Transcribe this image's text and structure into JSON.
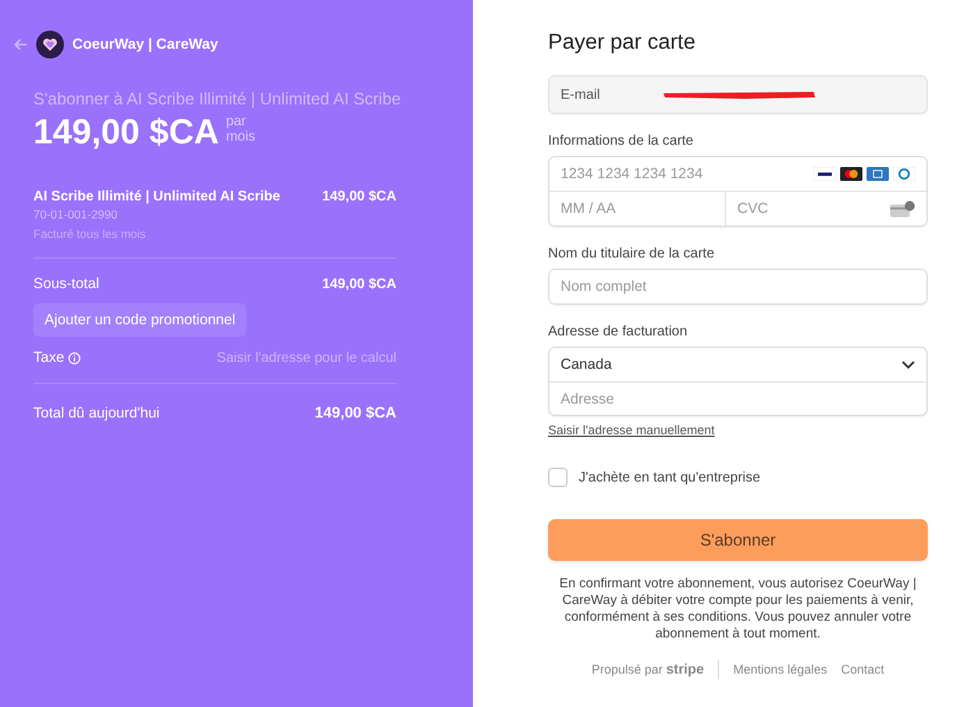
{
  "summary": {
    "brand": "CoeurWay | CareWay",
    "heading": "S'abonner à AI Scribe Illimité | Unlimited AI Scribe",
    "price": "149,00 $CA",
    "period": "par\nmois",
    "items": [
      {
        "name": "AI Scribe Illimité | Unlimited AI Scribe",
        "sku": "70-01-001-2990",
        "billing": "Facturé tous les mois",
        "amount": "149,00 $CA"
      }
    ],
    "subtotal": {
      "label": "Sous-total",
      "amount": "149,00 $CA"
    },
    "promo_button": "Ajouter un code promotionnel",
    "tax": {
      "label": "Taxe",
      "note": "Saisir l'adresse pour le calcul"
    },
    "total": {
      "label": "Total dû aujourd'hui",
      "amount": "149,00 $CA"
    }
  },
  "form": {
    "title": "Payer par carte",
    "email_label": "E-mail",
    "email_redacted": true,
    "card_label": "Informations de la carte",
    "card_number": {
      "placeholder": "1234 1234 1234 1234"
    },
    "expiry": {
      "placeholder": "MM / AA"
    },
    "cvc": {
      "placeholder": "CVC"
    },
    "name_label": "Nom du titulaire de la carte",
    "name": {
      "placeholder": "Nom complet"
    },
    "address_label": "Adresse de facturation",
    "country": "Canada",
    "address": {
      "placeholder": "Adresse"
    },
    "manual_link": "Saisir l'adresse manuellement",
    "business": {
      "label": "J'achète en tant qu'entreprise",
      "checked": false
    },
    "submit": "S'abonner",
    "disclaimer": "En confirmant votre abonnement, vous autorisez CoeurWay | CareWay à débiter votre compte pour les paiements à venir, conformément à ses conditions. Vous pouvez annuler votre abonnement à tout moment.",
    "footer": {
      "powered": "Propulsé par",
      "stripe": "stripe",
      "links": [
        "Mentions légales",
        "Contact"
      ]
    }
  }
}
